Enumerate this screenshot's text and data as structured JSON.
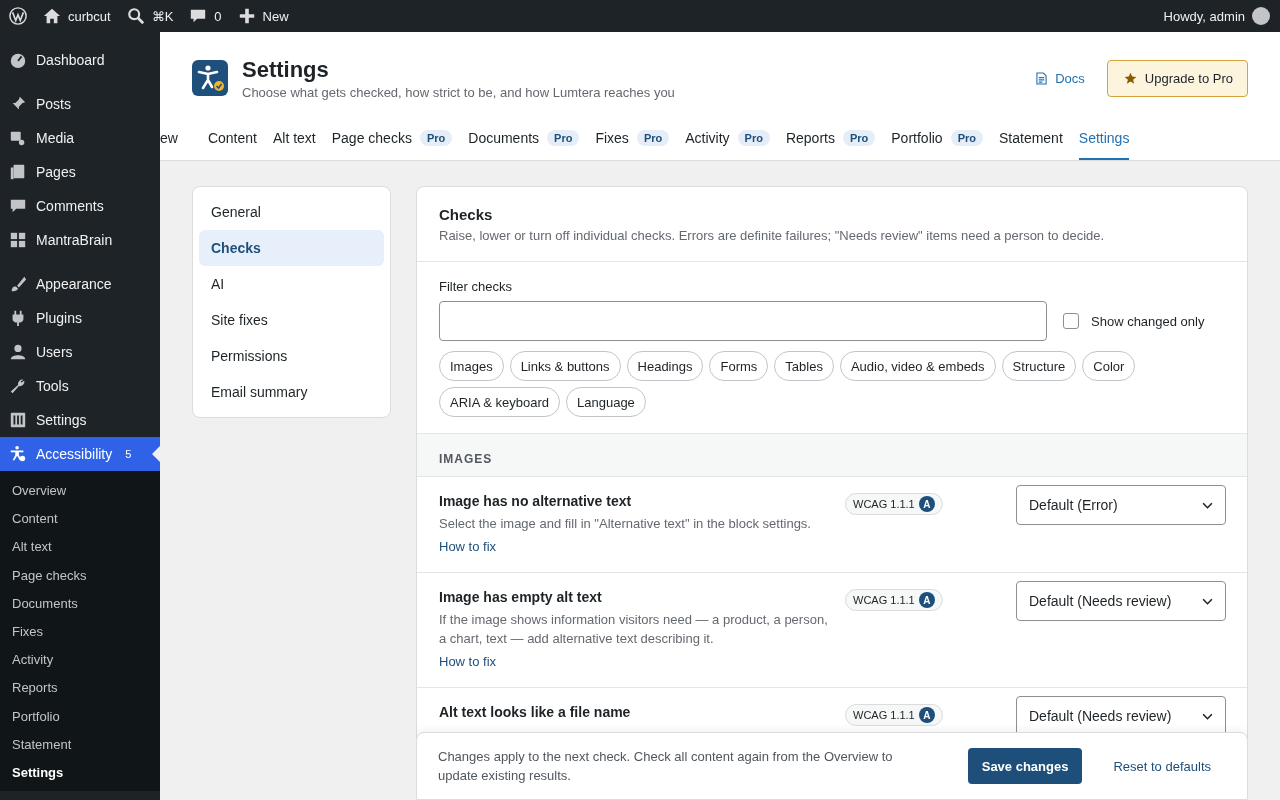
{
  "admin_bar": {
    "site": "curbcut",
    "search_shortcut": "⌘K",
    "comments": "0",
    "new": "New",
    "greeting": "Howdy, admin"
  },
  "sidebar": {
    "groups": [
      [
        {
          "label": "Dashboard",
          "selected": false
        }
      ],
      [
        {
          "label": "Posts",
          "selected": false
        },
        {
          "label": "Media",
          "selected": false
        },
        {
          "label": "Pages",
          "selected": false
        },
        {
          "label": "Comments",
          "selected": false
        },
        {
          "label": "MantraBrain",
          "selected": false
        }
      ],
      [
        {
          "label": "Appearance",
          "selected": false
        },
        {
          "label": "Plugins",
          "selected": false
        },
        {
          "label": "Users",
          "selected": false
        },
        {
          "label": "Tools",
          "selected": false
        },
        {
          "label": "Settings",
          "selected": false
        },
        {
          "label": "Accessibility",
          "selected": true,
          "count": "5"
        }
      ]
    ],
    "submenu": [
      {
        "label": "Overview",
        "selected": false
      },
      {
        "label": "Content",
        "selected": false
      },
      {
        "label": "Alt text",
        "selected": false
      },
      {
        "label": "Page checks",
        "selected": false
      },
      {
        "label": "Documents",
        "selected": false
      },
      {
        "label": "Fixes",
        "selected": false
      },
      {
        "label": "Activity",
        "selected": false
      },
      {
        "label": "Reports",
        "selected": false
      },
      {
        "label": "Portfolio",
        "selected": false
      },
      {
        "label": "Statement",
        "selected": false
      },
      {
        "label": "Settings",
        "selected": true
      }
    ]
  },
  "header": {
    "title": "Settings",
    "subtitle": "Choose what gets checked, how strict to be, and how Lumtera reaches you",
    "docs": "Docs",
    "upgrade": "Upgrade to Pro"
  },
  "tabs": [
    {
      "label": "ew",
      "selected": false
    },
    {
      "label": "Content",
      "selected": false
    },
    {
      "label": "Alt text",
      "selected": false
    },
    {
      "label": "Page checks",
      "badge": "Pro",
      "selected": false
    },
    {
      "label": "Documents",
      "badge": "Pro",
      "selected": false
    },
    {
      "label": "Fixes",
      "badge": "Pro",
      "selected": false
    },
    {
      "label": "Activity",
      "badge": "Pro",
      "selected": false
    },
    {
      "label": "Reports",
      "badge": "Pro",
      "selected": false
    },
    {
      "label": "Portfolio",
      "badge": "Pro",
      "selected": false
    },
    {
      "label": "Statement",
      "selected": false
    },
    {
      "label": "Settings",
      "selected": true
    }
  ],
  "settings_nav": [
    {
      "label": "General",
      "selected": false
    },
    {
      "label": "Checks",
      "selected": true
    },
    {
      "label": "AI",
      "selected": false
    },
    {
      "label": "Site fixes",
      "selected": false
    },
    {
      "label": "Permissions",
      "selected": false
    },
    {
      "label": "Email summary",
      "selected": false
    }
  ],
  "checks": {
    "title": "Checks",
    "description": "Raise, lower or turn off individual checks. Errors are definite failures; \"Needs review\" items need a person to decide.",
    "filter_label": "Filter checks",
    "show_changed_only": {
      "label": "Show changed only",
      "checked": false
    },
    "categories": [
      "Images",
      "Links & buttons",
      "Headings",
      "Forms",
      "Tables",
      "Audio, video & embeds",
      "Structure",
      "Color",
      "ARIA & keyboard",
      "Language"
    ],
    "section": "IMAGES",
    "rows": [
      {
        "title": "Image has no alternative text",
        "description": "Select the image and fill in \"Alternative text\" in the block settings.",
        "link": "How to fix",
        "wcag": "WCAG 1.1.1",
        "level": "A",
        "setting": "Default (Error)"
      },
      {
        "title": "Image has empty alt text",
        "description": "If the image shows information visitors need — a product, a person, a chart, text — add alternative text describing it.",
        "link": "How to fix",
        "wcag": "WCAG 1.1.1",
        "level": "A",
        "setting": "Default (Needs review)"
      },
      {
        "title": "Alt text looks like a file name",
        "wcag": "WCAG 1.1.1",
        "level": "A",
        "setting": "Default (Needs review)"
      }
    ]
  },
  "footer": {
    "note": "Changes apply to the next check. Check all content again from the Overview to update existing results.",
    "save": "Save changes",
    "reset": "Reset to defaults"
  }
}
